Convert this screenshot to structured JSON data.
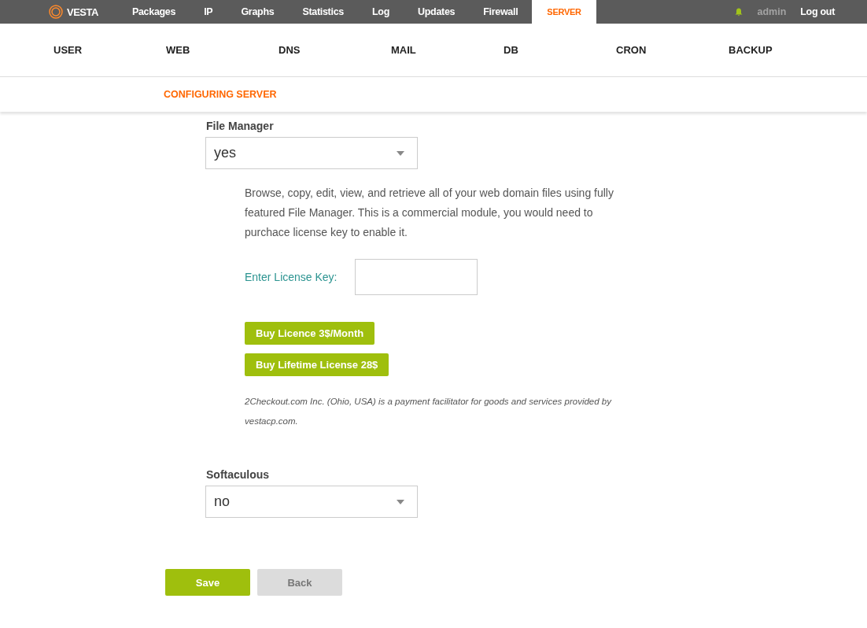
{
  "top_nav": {
    "logo": "VESTA",
    "items": [
      {
        "label": "Packages",
        "selected": false
      },
      {
        "label": "IP",
        "selected": false
      },
      {
        "label": "Graphs",
        "selected": false
      },
      {
        "label": "Statistics",
        "selected": false
      },
      {
        "label": "Log",
        "selected": false
      },
      {
        "label": "Updates",
        "selected": false
      },
      {
        "label": "Firewall",
        "selected": false
      },
      {
        "label": "SERVER",
        "selected": true
      }
    ],
    "user": "admin",
    "logout": "Log out"
  },
  "sub_nav": [
    "USER",
    "WEB",
    "DNS",
    "MAIL",
    "DB",
    "CRON",
    "BACKUP"
  ],
  "page_title": "CONFIGURING SERVER",
  "file_manager": {
    "label": "File Manager",
    "value": "yes",
    "description": "Browse, copy, edit, view, and retrieve all of your web domain files using fully featured File Manager. This is a commercial module, you would need to purchace license key to enable it.",
    "license_label": "Enter License Key:",
    "buy_buttons": [
      "Buy Licence 3$/Month",
      "Buy Lifetime License 28$"
    ],
    "note": "2Checkout.com Inc. (Ohio, USA) is a payment facilitator for goods and services provided by vestacp.com."
  },
  "softaculous": {
    "label": "Softaculous",
    "value": "no"
  },
  "buttons": {
    "save": "Save",
    "back": "Back"
  }
}
